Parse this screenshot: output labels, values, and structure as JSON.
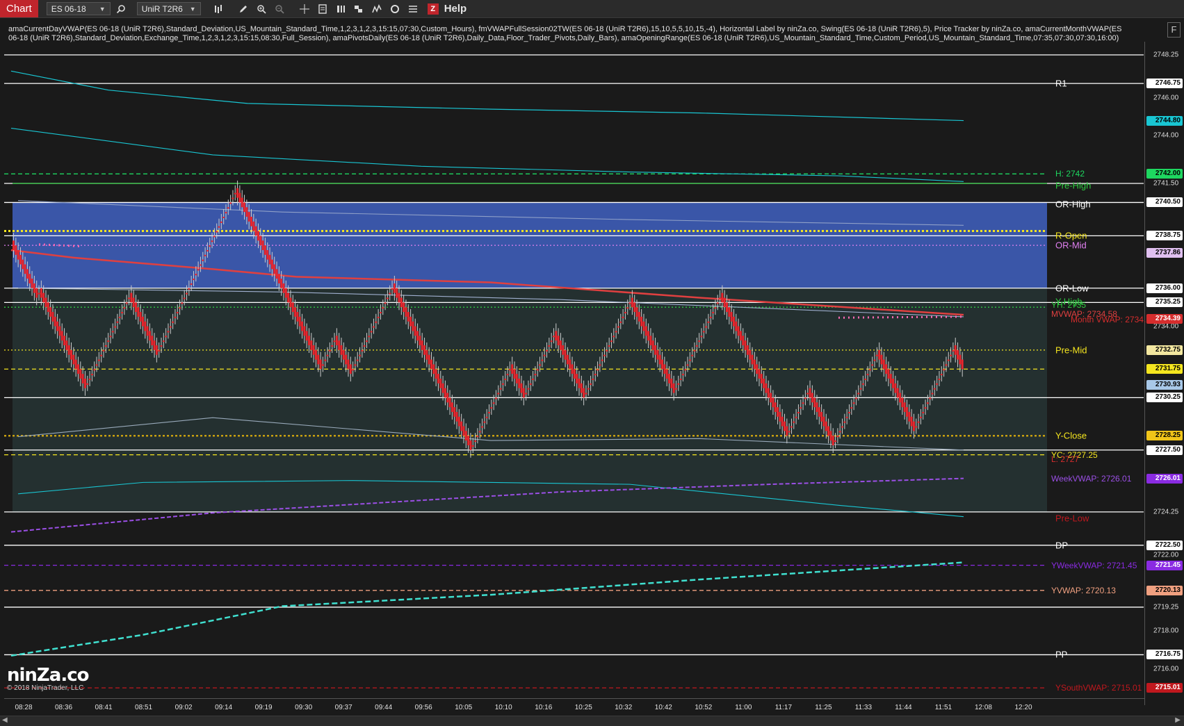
{
  "toolbar": {
    "tab": "Chart",
    "instrument": "ES 06-18",
    "bar_type": "UniR T2R6",
    "help": "Help",
    "z_icon": "Z",
    "icons": [
      "search-icon",
      "bar-style-icon",
      "pencil-icon",
      "zoom-in-icon",
      "zoom-out-icon",
      "crosshair-icon",
      "properties-icon",
      "strategies-icon",
      "templates-icon",
      "indicators-icon",
      "reload-icon",
      "data-box-icon"
    ]
  },
  "indicator_text": "amaCurrentDayVWAP(ES 06-18 (UniR T2R6),Standard_Deviation,US_Mountain_Standard_Time,1,2,3,1,2,3,15:15,07:30,Custom_Hours), fmVWAPFullSession02TW(ES 06-18 (UniR T2R6),15,10,5,5,10,15,-4), Horizontal Label by ninZa.co, Swing(ES 06-18 (UniR T2R6),5), Price Tracker by ninZa.co, amaCurrentMonthVWAP(ES 06-18 (UniR T2R6),Standard_Deviation,Exchange_Time,1,2,3,1,2,3,15:15,08:30,Full_Session), amaPivotsDaily(ES 06-18 (UniR T2R6),Daily_Data,Floor_Trader_Pivots,Daily_Bars), amaOpeningRange(ES 06-18 (UniR T2R6),US_Mountain_Standard_Time,Custom_Period,US_Mountain_Standard_Time,07:35,07:30,07:30,16:00)",
  "f_button": "F",
  "watermark": {
    "logo": "ninZa.co",
    "copyright": "© 2018 NinjaTrader, LLC"
  },
  "price_ticks": [
    "2748.25",
    "2746.00",
    "2744.00",
    "2741.50",
    "2734.00",
    "2724.25",
    "2722.00",
    "2719.25",
    "2718.00",
    "2716.00"
  ],
  "price_labels": [
    {
      "text": "2746.75",
      "bg": "#ffffff",
      "fg": "#000000"
    },
    {
      "text": "2744.80",
      "bg": "#19c6d3",
      "fg": "#000000"
    },
    {
      "text": "2742.00",
      "bg": "#1ed760",
      "fg": "#000000"
    },
    {
      "text": "2740.50",
      "bg": "#ffffff",
      "fg": "#000000"
    },
    {
      "text": "2738.75",
      "bg": "#ffffff",
      "fg": "#000000"
    },
    {
      "text": "2737.86",
      "bg": "#e0c0f0",
      "fg": "#000000"
    },
    {
      "text": "2736.00",
      "bg": "#ffffff",
      "fg": "#000000"
    },
    {
      "text": "2735.25",
      "bg": "#ffffff",
      "fg": "#000000"
    },
    {
      "text": "2734.39",
      "bg": "#d62d2d",
      "fg": "#ffffff"
    },
    {
      "text": "2732.75",
      "bg": "#f3e7a0",
      "fg": "#000000"
    },
    {
      "text": "2731.75",
      "bg": "#f5e61f",
      "fg": "#000000"
    },
    {
      "text": "2730.93",
      "bg": "#a8c8e8",
      "fg": "#000000"
    },
    {
      "text": "2730.25",
      "bg": "#ffffff",
      "fg": "#000000"
    },
    {
      "text": "2728.25",
      "bg": "#f0c419",
      "fg": "#000000"
    },
    {
      "text": "2727.50",
      "bg": "#ffffff",
      "fg": "#000000"
    },
    {
      "text": "2726.01",
      "bg": "#8a2be2",
      "fg": "#ffffff"
    },
    {
      "text": "2722.50",
      "bg": "#ffffff",
      "fg": "#000000"
    },
    {
      "text": "2721.45",
      "bg": "#8a2be2",
      "fg": "#ffffff"
    },
    {
      "text": "2720.13",
      "bg": "#f0a080",
      "fg": "#000000"
    },
    {
      "text": "2716.75",
      "bg": "#ffffff",
      "fg": "#000000"
    },
    {
      "text": "2715.01",
      "bg": "#c0181e",
      "fg": "#ffffff"
    }
  ],
  "level_labels": [
    {
      "text": "R1",
      "color": "#ffffff"
    },
    {
      "text": "H: 2742",
      "color": "#1ed760"
    },
    {
      "text": "Pre-High",
      "color": "#2ecc40"
    },
    {
      "text": "OR-High",
      "color": "#ffffff"
    },
    {
      "text": "R-Open",
      "color": "#f5e61f"
    },
    {
      "text": "OR-Mid",
      "color": "#e080f0"
    },
    {
      "text": "OR-Low",
      "color": "#ffffff"
    },
    {
      "text": "Y-High",
      "color": "#2ecc40"
    },
    {
      "text": "YH: 2735",
      "color": "#2ecc40"
    },
    {
      "text": "MVWAP: 2734.58",
      "color": "#e04040"
    },
    {
      "text": "Month VWAP: 2734.39",
      "color": "#d62d2d"
    },
    {
      "text": "Pre-Mid",
      "color": "#f5e61f"
    },
    {
      "text": "Y-Close",
      "color": "#f5e61f"
    },
    {
      "text": "YC: 2727.25",
      "color": "#f5e61f"
    },
    {
      "text": "L: 2727",
      "color": "#d62d2d"
    },
    {
      "text": "WeekVWAP: 2726.01",
      "color": "#9b4fe6"
    },
    {
      "text": "Pre-Low",
      "color": "#c0181e"
    },
    {
      "text": "DP",
      "color": "#ffffff"
    },
    {
      "text": "YWeekVWAP: 2721.45",
      "color": "#8a2be2"
    },
    {
      "text": "YVWAP: 2720.13",
      "color": "#f0a080"
    },
    {
      "text": "PP",
      "color": "#ffffff"
    },
    {
      "text": "YSouthVWAP: 2715.01",
      "color": "#c0181e"
    }
  ],
  "time_labels": [
    "08:28",
    "08:36",
    "08:41",
    "08:51",
    "09:02",
    "09:14",
    "09:19",
    "09:30",
    "09:37",
    "09:44",
    "09:56",
    "10:05",
    "10:10",
    "10:16",
    "10:25",
    "10:32",
    "10:42",
    "10:52",
    "11:00",
    "11:17",
    "11:25",
    "11:33",
    "11:44",
    "11:51",
    "12:08",
    "12:20"
  ],
  "colors": {
    "up": "#2ecc40",
    "down": "#e8262d",
    "or_box": "#3a56a8",
    "lower_shade": "#243030",
    "bg": "#1a1a1a"
  },
  "chart_data": {
    "type": "candlestick",
    "instrument": "ES 06-18",
    "bar_type": "UniR T2R6",
    "closes": [
      2738,
      2737.75,
      2737.5,
      2737.25,
      2737,
      2736.75,
      2736.5,
      2736.25,
      2736,
      2735.75,
      2735.5,
      2735.75,
      2735.5,
      2735.25,
      2735,
      2734.75,
      2734.5,
      2734.25,
      2734,
      2733.75,
      2733.5,
      2733.25,
      2733,
      2732.75,
      2732.5,
      2732.25,
      2732,
      2731.75,
      2731.5,
      2731.25,
      2731,
      2730.75,
      2731,
      2731.25,
      2731.5,
      2731.75,
      2732,
      2732.25,
      2732.5,
      2732.75,
      2733,
      2733.25,
      2733.5,
      2733.75,
      2734,
      2734.25,
      2734.5,
      2734.75,
      2735,
      2735.25,
      2735.5,
      2735.25,
      2735,
      2734.75,
      2734.5,
      2734.25,
      2734,
      2733.75,
      2733.5,
      2733.25,
      2733,
      2732.75,
      2732.5,
      2732.75,
      2733,
      2733.25,
      2733.5,
      2733.75,
      2734,
      2734.25,
      2734.5,
      2734.75,
      2735,
      2735.25,
      2735.5,
      2735.75,
      2736,
      2736.25,
      2736.5,
      2736.75,
      2737,
      2737.25,
      2737.5,
      2737.75,
      2738,
      2738.25,
      2738.5,
      2738.75,
      2739,
      2739.25,
      2739.5,
      2739.75,
      2740,
      2740.25,
      2740.5,
      2740.75,
      2741,
      2740.75,
      2740.5,
      2740.25,
      2740,
      2739.75,
      2739.5,
      2739.25,
      2739,
      2738.75,
      2738.5,
      2738.25,
      2738,
      2737.75,
      2737.5,
      2737.25,
      2737,
      2736.75,
      2736.5,
      2736.25,
      2736,
      2735.75,
      2735.5,
      2735.25,
      2735,
      2734.75,
      2734.5,
      2734.25,
      2734,
      2733.75,
      2733.5,
      2733.25,
      2733,
      2732.75,
      2732.5,
      2732.25,
      2732,
      2731.75,
      2732,
      2732.25,
      2732.5,
      2732.75,
      2733,
      2733.25,
      2733,
      2732.75,
      2732.5,
      2732.25,
      2732,
      2731.75,
      2731.5,
      2731.75,
      2732,
      2732.25,
      2732.5,
      2732.75,
      2733,
      2733.25,
      2733.5,
      2733.75,
      2734,
      2734.25,
      2734.5,
      2734.75,
      2735,
      2735.25,
      2735.5,
      2735.75,
      2736,
      2735.75,
      2735.5,
      2735.25,
      2735,
      2734.75,
      2734.5,
      2734.25,
      2734,
      2733.75,
      2733.5,
      2733.25,
      2733,
      2732.75,
      2732.5,
      2732.25,
      2732,
      2731.75,
      2731.5,
      2731.25,
      2731,
      2730.75,
      2730.5,
      2730.25,
      2730,
      2729.75,
      2729.5,
      2729.25,
      2729,
      2728.75,
      2728.5,
      2728.25,
      2728,
      2727.75,
      2727.5,
      2727.75,
      2728,
      2728.25,
      2728.5,
      2728.75,
      2729,
      2729.25,
      2729.5,
      2729.75,
      2730,
      2730.25,
      2730.5,
      2730.75,
      2731,
      2731.25,
      2731.5,
      2731.75,
      2731.5,
      2731.25,
      2731,
      2730.75,
      2730.5,
      2730.25,
      2730.5,
      2730.75,
      2731,
      2731.25,
      2731.5,
      2731.75,
      2732,
      2732.25,
      2732.5,
      2732.75,
      2733,
      2733.25,
      2733.5,
      2733.25,
      2733,
      2732.75,
      2732.5,
      2732.25,
      2732,
      2731.75,
      2731.5,
      2731.25,
      2731,
      2730.75,
      2730.5,
      2730.25,
      2730.5,
      2730.75,
      2731,
      2731.25,
      2731.5,
      2731.75,
      2732,
      2732.25,
      2732.5,
      2732.75,
      2733,
      2733.25,
      2733.5,
      2733.75,
      2734,
      2734.25,
      2734.5,
      2734.75,
      2735,
      2735.25,
      2735,
      2734.75,
      2734.5,
      2734.25,
      2734,
      2733.75,
      2733.5,
      2733.25,
      2733,
      2732.75,
      2732.5,
      2732.25,
      2732,
      2731.75,
      2731.5,
      2731.25,
      2731,
      2730.75,
      2730.5,
      2730.75,
      2731,
      2731.25,
      2731.5,
      2731.75,
      2732,
      2732.25,
      2732.5,
      2732.75,
      2733,
      2733.25,
      2733.5,
      2733.75,
      2734,
      2734.25,
      2734.5,
      2734.75,
      2735,
      2735.25,
      2735.5,
      2735.25,
      2735,
      2734.75,
      2734.5,
      2734.25,
      2734,
      2733.75,
      2733.5,
      2733.25,
      2733,
      2732.75,
      2732.5,
      2732.25,
      2732,
      2731.75,
      2731.5,
      2731.25,
      2731,
      2730.75,
      2730.5,
      2730.25,
      2730,
      2729.75,
      2729.5,
      2729.25,
      2729,
      2728.75,
      2728.5,
      2728.25,
      2728.5,
      2728.75,
      2729,
      2729.25,
      2729.5,
      2729.75,
      2730,
      2730.25,
      2730.5,
      2730.25,
      2730,
      2729.75,
      2729.5,
      2729.25,
      2729,
      2728.75,
      2728.5,
      2728.25,
      2728,
      2727.75,
      2728,
      2728.25,
      2728.5,
      2728.75,
      2729,
      2729.25,
      2729.5,
      2729.75,
      2730,
      2730.25,
      2730.5,
      2730.75,
      2731,
      2731.25,
      2731.5,
      2731.75,
      2732,
      2732.25,
      2732.5,
      2732.25,
      2732,
      2731.75,
      2731.5,
      2731.25,
      2731,
      2730.75,
      2730.5,
      2730.25,
      2730,
      2729.75,
      2729.5,
      2729.25,
      2729,
      2728.75,
      2728.5,
      2728.75,
      2729,
      2729.25,
      2729.5,
      2729.75,
      2730,
      2730.25,
      2730.5,
      2730.75,
      2731,
      2731.25,
      2731.5,
      2731.75,
      2732,
      2732.25,
      2732.5,
      2732.75,
      2732.5,
      2732.25,
      2732,
      2731.75
    ],
    "levels": [
      {
        "name": "R1",
        "price": 2746.75
      },
      {
        "name": "H",
        "price": 2742
      },
      {
        "name": "Pre-High",
        "price": 2741.5
      },
      {
        "name": "OR-High",
        "price": 2740.5
      },
      {
        "name": "R-Open",
        "price": 2739
      },
      {
        "name": "OR-Mid",
        "price": 2738.25
      },
      {
        "name": "OR-Low",
        "price": 2736
      },
      {
        "name": "Y-High",
        "price": 2735.25
      },
      {
        "name": "MVWAP",
        "price": 2734.58
      },
      {
        "name": "Month VWAP",
        "price": 2734.39
      },
      {
        "name": "Pre-Mid",
        "price": 2732.75
      },
      {
        "name": "Y-Close",
        "price": 2728.25
      },
      {
        "name": "YC",
        "price": 2727.25
      },
      {
        "name": "L",
        "price": 2727
      },
      {
        "name": "WeekVWAP",
        "price": 2726.01
      },
      {
        "name": "DP",
        "price": 2722.5
      },
      {
        "name": "YWeekVWAP",
        "price": 2721.45
      },
      {
        "name": "YVWAP",
        "price": 2720.13
      },
      {
        "name": "PP",
        "price": 2716.75
      },
      {
        "name": "YSouthVWAP",
        "price": 2715.01
      }
    ],
    "ylim": [
      2714.5,
      2748.75
    ],
    "last_price": 2731.75
  }
}
